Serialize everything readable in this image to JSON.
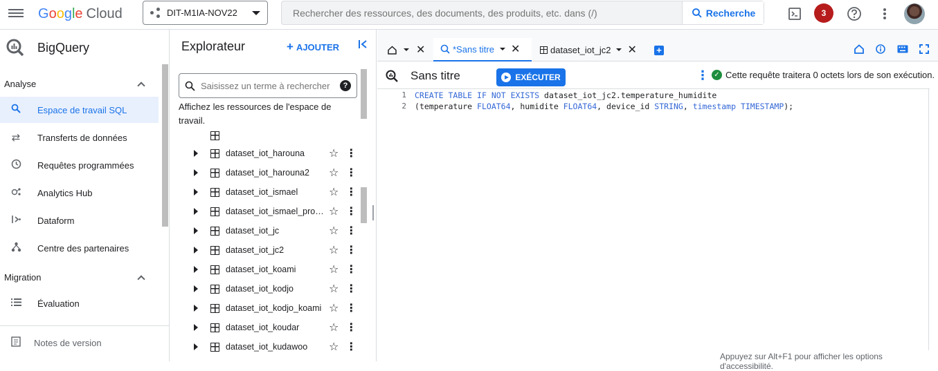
{
  "topbar": {
    "logo_letters": [
      "G",
      "o",
      "o",
      "g",
      "l",
      "e"
    ],
    "logo_product": "Cloud",
    "project": "DIT-M1IA-NOV22",
    "search_placeholder": "Rechercher des ressources, des documents, des produits, etc. dans (/)",
    "search_button": "Recherche",
    "notification_count": "3"
  },
  "leftnav": {
    "product_title": "BigQuery",
    "sections": [
      {
        "label": "Analyse",
        "items": [
          {
            "label": "Espace de travail SQL",
            "icon": "search-icon",
            "active": true
          },
          {
            "label": "Transferts de données",
            "icon": "transfer-icon"
          },
          {
            "label": "Requêtes programmées",
            "icon": "clock-icon"
          },
          {
            "label": "Analytics Hub",
            "icon": "hub-icon"
          },
          {
            "label": "Dataform",
            "icon": "dataform-icon"
          },
          {
            "label": "Centre des partenaires",
            "icon": "partners-icon"
          }
        ]
      },
      {
        "label": "Migration",
        "items": [
          {
            "label": "Évaluation",
            "icon": "list-icon"
          }
        ]
      }
    ],
    "footer": "Notes de version"
  },
  "explorer": {
    "title": "Explorateur",
    "add_label": "AJOUTER",
    "search_placeholder": "Saisissez un terme à rechercher",
    "hint": "Affichez les ressources de l'espace de travail.",
    "datasets": [
      "dataset_iot_harouna",
      "dataset_iot_harouna2",
      "dataset_iot_ismael",
      "dataset_iot_ismael_proje…",
      "dataset_iot_jc",
      "dataset_iot_jc2",
      "dataset_iot_koami",
      "dataset_iot_kodjo",
      "dataset_iot_kodjo_koami",
      "dataset_iot_koudar",
      "dataset_iot_kudawoo"
    ]
  },
  "editor": {
    "tabs": [
      {
        "label": "*Sans titre",
        "active": true
      },
      {
        "label": "dataset_iot_jc2",
        "active": false
      }
    ],
    "query_title": "Sans titre",
    "run_label": "EXÉCUTER",
    "status": "Cette requête traitera 0 octets lors de son exécution.",
    "line_numbers": [
      "1",
      "2"
    ],
    "code_lines": [
      "CREATE TABLE IF NOT EXISTS dataset_iot_jc2.temperature_humidite",
      "(temperature FLOAT64, humidite FLOAT64, device_id STRING, timestamp TIMESTAMP);"
    ]
  },
  "accessibility_hint": "Appuyez sur Alt+F1 pour afficher les options d'accessibilité.",
  "colors": {
    "accent": "#1a73e8",
    "active_bg": "#e8f0fe",
    "badge": "#b71c1c",
    "ok": "#1e8e3e"
  }
}
